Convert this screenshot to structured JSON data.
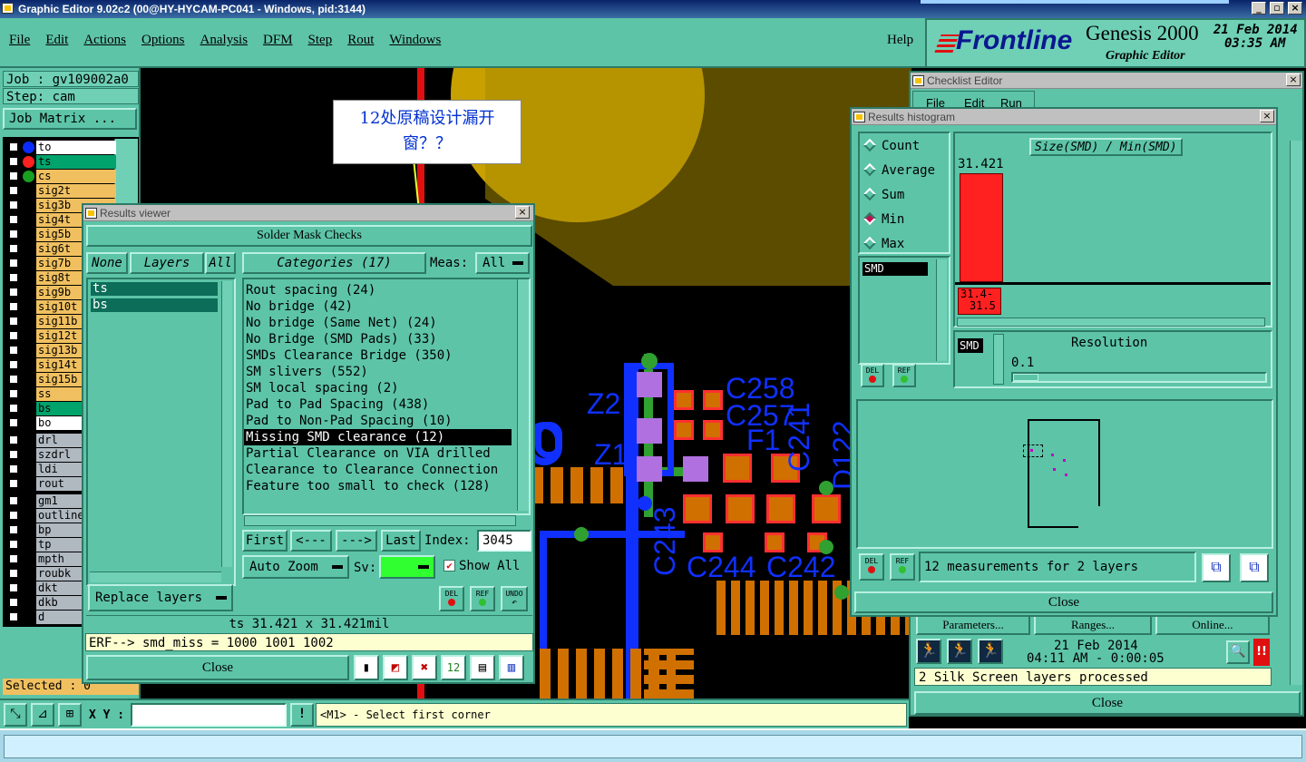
{
  "window": {
    "title": "Graphic Editor 9.02c2 (00@HY-HYCAM-PC041 - Windows, pid:3144)"
  },
  "menu": {
    "items": [
      "File",
      "Edit",
      "Actions",
      "Options",
      "Analysis",
      "DFM",
      "Step",
      "Rout",
      "Windows"
    ],
    "help": "Help"
  },
  "brand": {
    "logo": "Frontline",
    "product": "Genesis 2000",
    "subtitle": "Graphic Editor",
    "date": "21 Feb 2014",
    "time": "03:35 AM"
  },
  "left": {
    "job": "Job : gv109002a0",
    "step": "Step: cam",
    "job_matrix": "Job Matrix ...",
    "selected": "Selected : 0"
  },
  "layers": [
    {
      "name": "to",
      "bg": "#ffffff",
      "dot": "#0a2cff"
    },
    {
      "name": "ts",
      "bg": "#00a36c",
      "dot": "#ff2020",
      "active": true
    },
    {
      "name": "cs",
      "bg": "#f0c060",
      "dot": "#18a020"
    },
    {
      "name": "sig2t",
      "bg": "#f0c060"
    },
    {
      "name": "sig3b",
      "bg": "#f0c060"
    },
    {
      "name": "sig4t",
      "bg": "#f0c060"
    },
    {
      "name": "sig5b",
      "bg": "#f0c060"
    },
    {
      "name": "sig6t",
      "bg": "#f0c060"
    },
    {
      "name": "sig7b",
      "bg": "#f0c060"
    },
    {
      "name": "sig8t",
      "bg": "#f0c060"
    },
    {
      "name": "sig9b",
      "bg": "#f0c060"
    },
    {
      "name": "sig10t",
      "bg": "#f0c060"
    },
    {
      "name": "sig11b",
      "bg": "#f0c060"
    },
    {
      "name": "sig12t",
      "bg": "#f0c060"
    },
    {
      "name": "sig13b",
      "bg": "#f0c060"
    },
    {
      "name": "sig14t",
      "bg": "#f0c060"
    },
    {
      "name": "sig15b",
      "bg": "#f0c060"
    },
    {
      "name": "ss",
      "bg": "#f0c060"
    },
    {
      "name": "bs",
      "bg": "#00a36c"
    },
    {
      "name": "bo",
      "bg": "#ffffff"
    },
    {
      "name": "drl",
      "bg": "#b0b8c0"
    },
    {
      "name": "szdrl",
      "bg": "#b0b8c0"
    },
    {
      "name": "ldi",
      "bg": "#b0b8c0"
    },
    {
      "name": "rout",
      "bg": "#b0b8c0"
    },
    {
      "name": "gm1",
      "bg": "#b0b8c0"
    },
    {
      "name": "outline",
      "bg": "#b0b8c0"
    },
    {
      "name": "bp",
      "bg": "#b0b8c0"
    },
    {
      "name": "tp",
      "bg": "#b0b8c0"
    },
    {
      "name": "mpth",
      "bg": "#b0b8c0"
    },
    {
      "name": "roubk",
      "bg": "#b0b8c0"
    },
    {
      "name": "dkt",
      "bg": "#b0b8c0"
    },
    {
      "name": "dkb",
      "bg": "#b0b8c0"
    },
    {
      "name": "d",
      "bg": "#b0b8c0"
    }
  ],
  "annotation": {
    "line1": "12处原稿设计漏开",
    "line2": "窗？？"
  },
  "pcb_labels": [
    "Z2",
    "Z1",
    "C258",
    "C257",
    "F1",
    "C241",
    "D122",
    "C243",
    "C244",
    "C242"
  ],
  "results_viewer": {
    "title": "Results viewer",
    "header": "Solder Mask Checks",
    "none": "None",
    "layers": "Layers",
    "all": "All",
    "categories": "Categories (17)",
    "meas": "Meas:",
    "meas_value": "All",
    "layer_list": [
      "ts",
      "bs"
    ],
    "category_list": [
      "Rout spacing (24)",
      "No bridge (42)",
      "No bridge (Same Net) (24)",
      "No Bridge (SMD Pads) (33)",
      "SMDs Clearance Bridge (350)",
      "SM slivers (552)",
      "SM local spacing (2)",
      "Pad to Pad Spacing (438)",
      "Pad to Non-Pad Spacing (10)",
      "Missing SMD clearance (12)",
      "Partial Clearance on VIA drilled",
      "Clearance to Clearance Connection",
      "Feature too small to check (128)"
    ],
    "selected_index": 9,
    "first": "First",
    "prev": "<---",
    "next": "--->",
    "last": "Last",
    "index_label": "Index:",
    "index_value": "3045",
    "auto_zoom": "Auto Zoom",
    "sv": "Sv:",
    "show_all": "Show All",
    "replace_layers": "Replace layers",
    "del": "DEL",
    "ref": "REF",
    "undo": "UNDO",
    "measure": "ts 31.421 x 31.421mil",
    "erf": "ERF--> smd_miss = 1000 1001 1002",
    "close": "Close"
  },
  "histogram": {
    "title": "Results histogram",
    "radio": [
      "Count",
      "Average",
      "Sum",
      "Min",
      "Max"
    ],
    "selected": "Min",
    "chart_title": "Size(SMD) / Min(SMD)",
    "peak": "31.421",
    "range_label_1": "31.4-",
    "range_label_2": "31.5",
    "list": [
      "SMD"
    ],
    "smd_tag": "SMD",
    "resolution": "Resolution",
    "res_value": "0.1",
    "del": "DEL",
    "ref": "REF",
    "measurements": "12 measurements for 2 layers",
    "close": "Close",
    "chart_data": {
      "type": "bar",
      "categories": [
        "31.4-31.5"
      ],
      "values": [
        12
      ],
      "title": "Size(SMD) / Min(SMD)",
      "xlabel": "",
      "ylabel": ""
    }
  },
  "checklist": {
    "title": "Checklist Editor",
    "menu": [
      "File",
      "Edit",
      "Run"
    ],
    "parameters": "Parameters...",
    "ranges": "Ranges...",
    "online": "Online...",
    "date": "21 Feb 2014",
    "time": "04:11 AM - 0:00:05",
    "status": "2 Silk Screen layers processed",
    "close": "Close"
  },
  "statusbar": {
    "xy": "X Y :",
    "message": "<M1> - Select first corner"
  }
}
